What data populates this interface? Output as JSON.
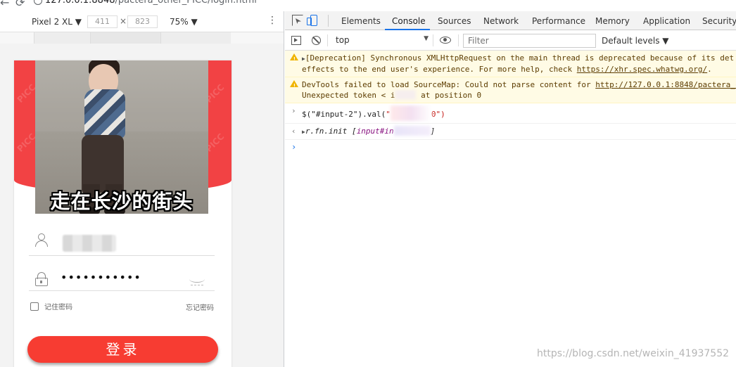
{
  "browser": {
    "url_host": "127.0.0.1:8848",
    "url_path": "/pactera_other_PICC/login.html"
  },
  "device_toolbar": {
    "device_name": "Pixel 2 XL",
    "width": "411",
    "height": "823",
    "zoom": "75%"
  },
  "login_page": {
    "caption": "走在长沙的街头",
    "password_mask": "•••••••••••",
    "remember_label": "记住密码",
    "forgot_label": "忘记密码",
    "login_button": "登录",
    "brand_color": "#f24244",
    "button_color": "#f73c32"
  },
  "devtools": {
    "tabs": [
      "Elements",
      "Console",
      "Sources",
      "Network",
      "Performance",
      "Memory",
      "Application",
      "Security"
    ],
    "active_tab": "Console",
    "context": "top",
    "filter_placeholder": "Filter",
    "levels": "Default levels",
    "messages": {
      "warn1_line1": "[Deprecation] Synchronous XMLHttpRequest on the main thread is deprecated because of its det",
      "warn1_line2_pre": "effects to the end user's experience. For more help, check ",
      "warn1_link": "https://xhr.spec.whatwg.org/",
      "warn1_line2_post": ".",
      "warn2_line1_pre": "DevTools failed to load SourceMap: Could not parse content for ",
      "warn2_link": "http://127.0.0.1:8848/pactera_c",
      "warn2_line2_pre": "Unexpected token < i",
      "warn2_line2_post": " at position 0",
      "input_pre": "$(\"#input-2\").val(",
      "input_str_end": "0\")",
      "result_pre": "r.fn.init [",
      "result_tag": "input#in",
      "result_post": "]"
    }
  },
  "watermark": "https://blog.csdn.net/weixin_41937552",
  "icons": {
    "back": "back-arrow-icon",
    "reload": "reload-icon",
    "inspect": "inspect-element-icon",
    "device": "device-toggle-icon",
    "sidebar": "console-sidebar-icon",
    "clear": "clear-console-icon",
    "eye": "live-expression-icon",
    "warn": "warning-icon",
    "user": "user-icon",
    "lock": "lock-icon"
  }
}
